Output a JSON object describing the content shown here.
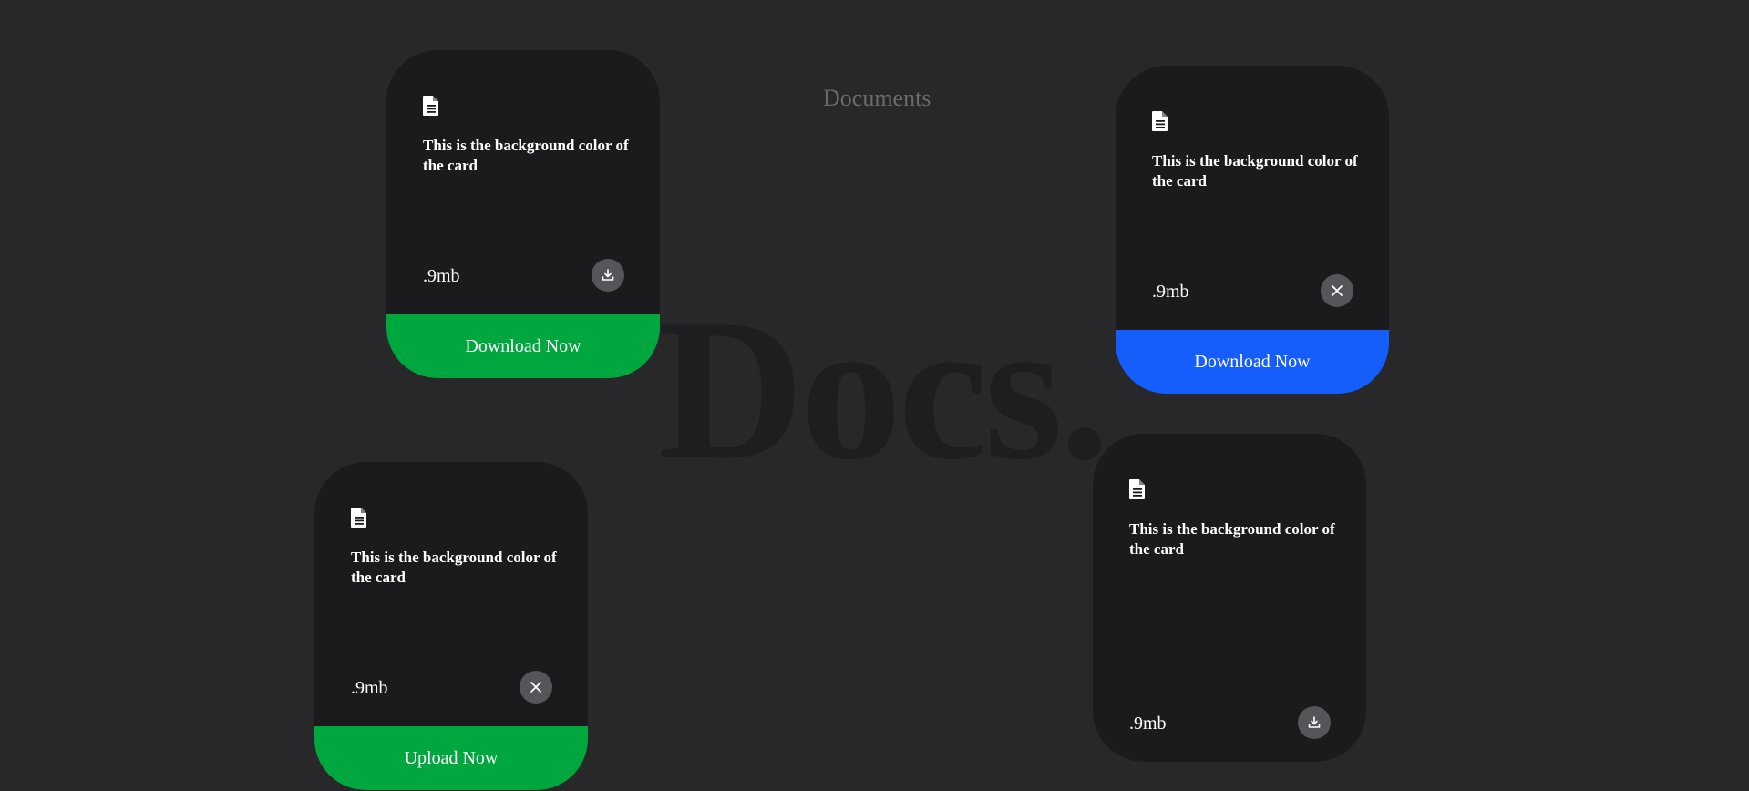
{
  "page": {
    "title": "Documents",
    "hero_text": "Docs."
  },
  "colors": {
    "background": "#28282a",
    "card": "#1b1b1d",
    "green_action": "#00a63e",
    "blue_action": "#155dfc",
    "round_button": "#55555a"
  },
  "cards": [
    {
      "icon": "file-text-icon",
      "description": "This is the background color of the card",
      "size": ".9mb",
      "button_icon": "download-icon",
      "action_label": "Download Now",
      "action_color": "green"
    },
    {
      "icon": "file-text-icon",
      "description": "This is the background color of the card",
      "size": ".9mb",
      "button_icon": "close-icon",
      "action_label": "Download Now",
      "action_color": "blue"
    },
    {
      "icon": "file-text-icon",
      "description": "This is the background color of the card",
      "size": ".9mb",
      "button_icon": "close-icon",
      "action_label": "Upload Now",
      "action_color": "green"
    },
    {
      "icon": "file-text-icon",
      "description": "This is the background color of the card",
      "size": ".9mb",
      "button_icon": "download-icon"
    }
  ]
}
